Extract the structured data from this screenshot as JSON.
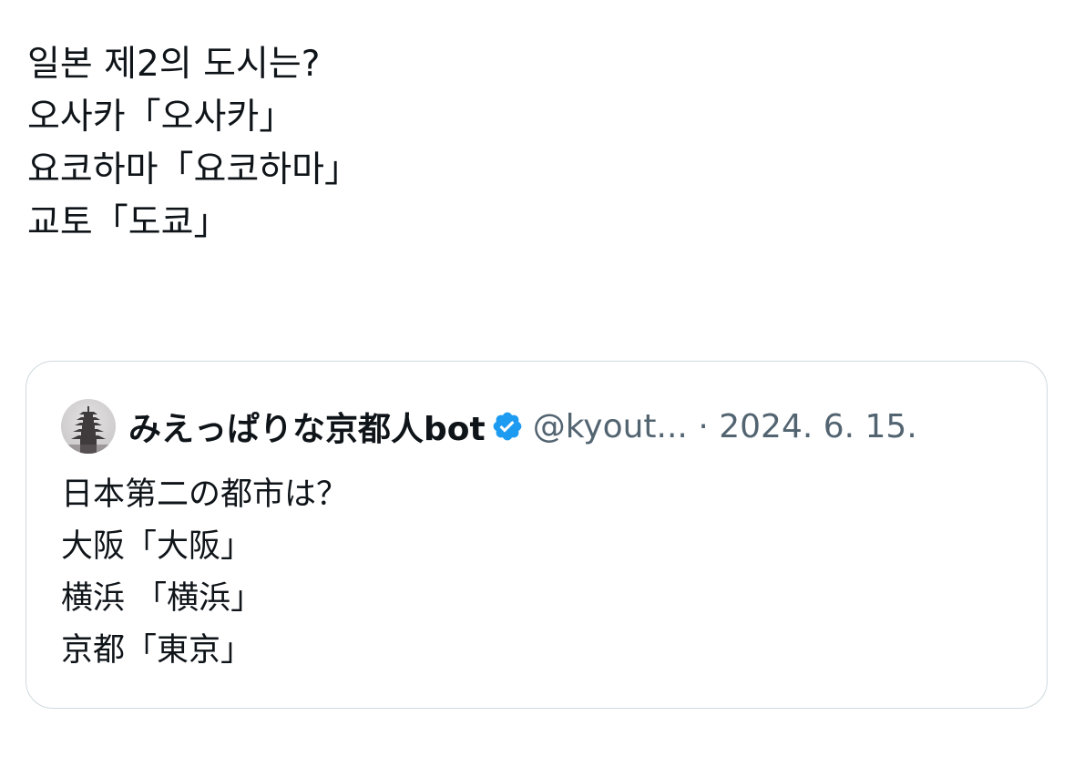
{
  "tweet": {
    "lines": [
      "일본 제2의 도시는?",
      "오사카「오사카」",
      "요코하마「요코하마」",
      "교토「도쿄」"
    ]
  },
  "quoted_tweet": {
    "avatar_icon": "pagoda-avatar-icon",
    "display_name": "みえっぱりな京都人bot",
    "verified_icon": "verified-badge-icon",
    "verified_color": "#1d9bf0",
    "handle": "@kyout...",
    "separator": "·",
    "date": "2024. 6. 15.",
    "lines": [
      "日本第二の都市は？",
      "大阪「大阪」",
      "横浜 「横浜」",
      "京都「東京」"
    ]
  },
  "colors": {
    "text": "#0f1419",
    "secondary_text": "#536471",
    "card_border": "#cfd9de",
    "background": "#ffffff"
  }
}
